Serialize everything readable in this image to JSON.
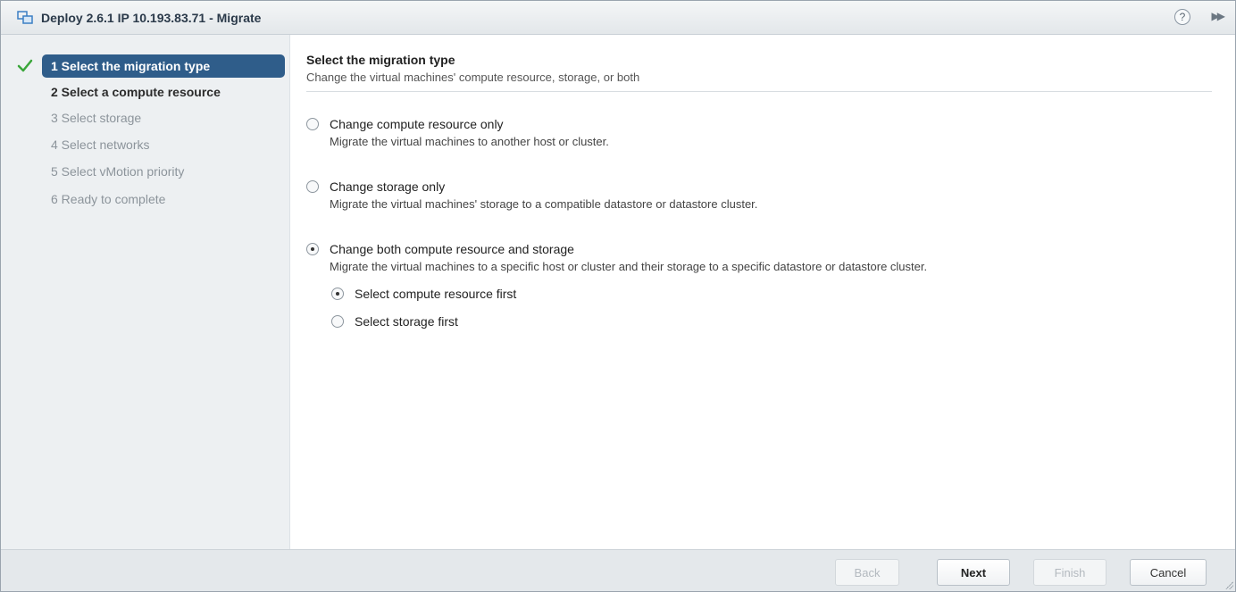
{
  "window": {
    "title": "Deploy 2.6.1 IP 10.193.83.71 - Migrate",
    "help_glyph": "?",
    "expand_glyph": "▶▶"
  },
  "steps": [
    {
      "label": "1  Select the migration type",
      "state": "current"
    },
    {
      "label": "2  Select a compute resource",
      "state": "next"
    },
    {
      "label": "3  Select storage",
      "state": "disabled"
    },
    {
      "label": "4  Select networks",
      "state": "disabled"
    },
    {
      "label": "5  Select vMotion priority",
      "state": "disabled"
    },
    {
      "label": "6  Ready to complete",
      "state": "disabled"
    }
  ],
  "main": {
    "title": "Select the migration type",
    "subtitle": "Change the virtual machines' compute resource, storage, or both",
    "options": [
      {
        "label": "Change compute resource only",
        "description": "Migrate the virtual machines to another host or cluster.",
        "checked": false
      },
      {
        "label": "Change storage only",
        "description": "Migrate the virtual machines' storage to a compatible datastore or datastore cluster.",
        "checked": false
      },
      {
        "label": "Change both compute resource and storage",
        "description": "Migrate the virtual machines to a specific host or cluster and their storage to a specific datastore or datastore cluster.",
        "checked": true
      }
    ],
    "sub_options": [
      {
        "label": "Select compute resource first",
        "checked": true
      },
      {
        "label": "Select storage first",
        "checked": false
      }
    ]
  },
  "footer": {
    "back_label": "Back",
    "next_label": "Next",
    "finish_label": "Finish",
    "cancel_label": "Cancel"
  },
  "colors": {
    "current_step_bg": "#2f5d8a",
    "check_green": "#3aa63a",
    "sidebar_bg": "#edf0f2"
  }
}
